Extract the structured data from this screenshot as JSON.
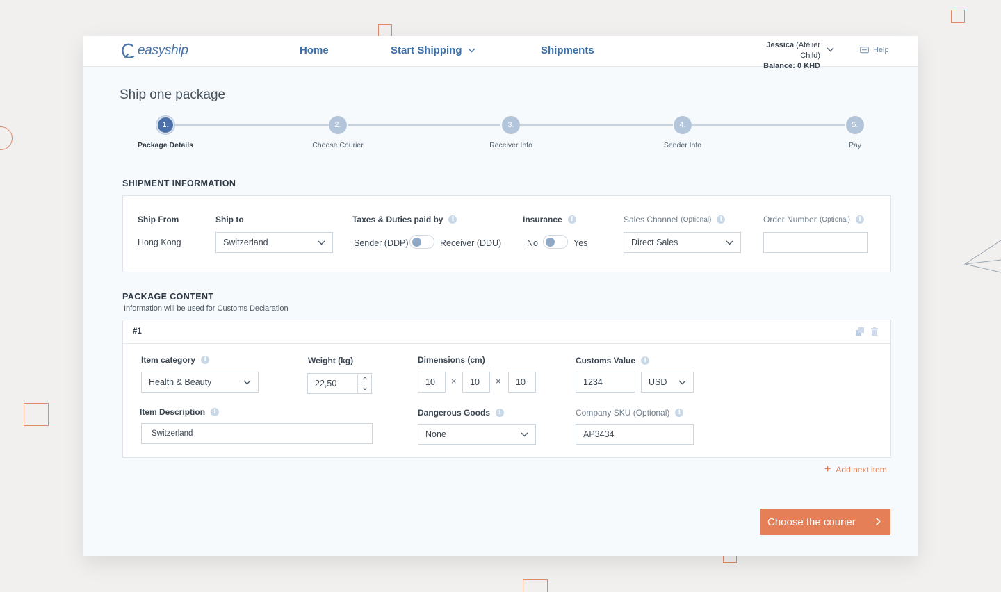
{
  "brand": {
    "name": "easyship"
  },
  "nav": {
    "home": "Home",
    "start_shipping": "Start Shipping",
    "shipments": "Shipments"
  },
  "account": {
    "name": "Jessica",
    "company": "(Atelier Child)",
    "balance_label": "Balance:",
    "balance_value": "0 KHD"
  },
  "help": "Help",
  "page_title": "Ship one package",
  "steps": [
    {
      "num": "1.",
      "label": "Package Details",
      "active": true
    },
    {
      "num": "2.",
      "label": "Choose Courier",
      "active": false
    },
    {
      "num": "3.",
      "label": "Receiver Info",
      "active": false
    },
    {
      "num": "4.",
      "label": "Sender Info",
      "active": false
    },
    {
      "num": "5.",
      "label": "Pay",
      "active": false
    }
  ],
  "shipment_info": {
    "title": "SHIPMENT INFORMATION",
    "ship_from_label": "Ship From",
    "ship_from_value": "Hong Kong",
    "ship_to_label": "Ship to",
    "ship_to_value": "Switzerland",
    "taxes_label": "Taxes & Duties paid by",
    "taxes_sender": "Sender (DDP)",
    "taxes_receiver": "Receiver (DDU)",
    "insurance_label": "Insurance",
    "insurance_no": "No",
    "insurance_yes": "Yes",
    "sales_channel_label": "Sales Channel",
    "sales_channel_optional": "(Optional)",
    "sales_channel_value": "Direct Sales",
    "order_number_label": "Order Number",
    "order_number_optional": "(Optional)",
    "order_number_value": ""
  },
  "package_content": {
    "title": "PACKAGE CONTENT",
    "subtitle": "Information will be used for Customs Declaration",
    "item_number": "#1",
    "item_category_label": "Item category",
    "item_category_value": "Health & Beauty",
    "weight_label": "Weight (kg)",
    "weight_value": "22,50",
    "dimensions_label": "Dimensions (cm)",
    "dim_l": "10",
    "dim_w": "10",
    "dim_h": "10",
    "times": "×",
    "customs_value_label": "Customs Value",
    "customs_value": "1234",
    "currency": "USD",
    "item_description_label": "Item Description",
    "item_description_value": "Switzerland",
    "dangerous_goods_label": "Dangerous Goods",
    "dangerous_goods_value": "None",
    "sku_label": "Company SKU (Optional)",
    "sku_value": "AP3434",
    "add_next_item": "Add next item"
  },
  "cta": "Choose the courier",
  "colors": {
    "accent": "#e57f58",
    "brand_blue": "#3b6fa8",
    "step_active": "#4a6fa9",
    "step_inactive": "#b3c5da"
  }
}
